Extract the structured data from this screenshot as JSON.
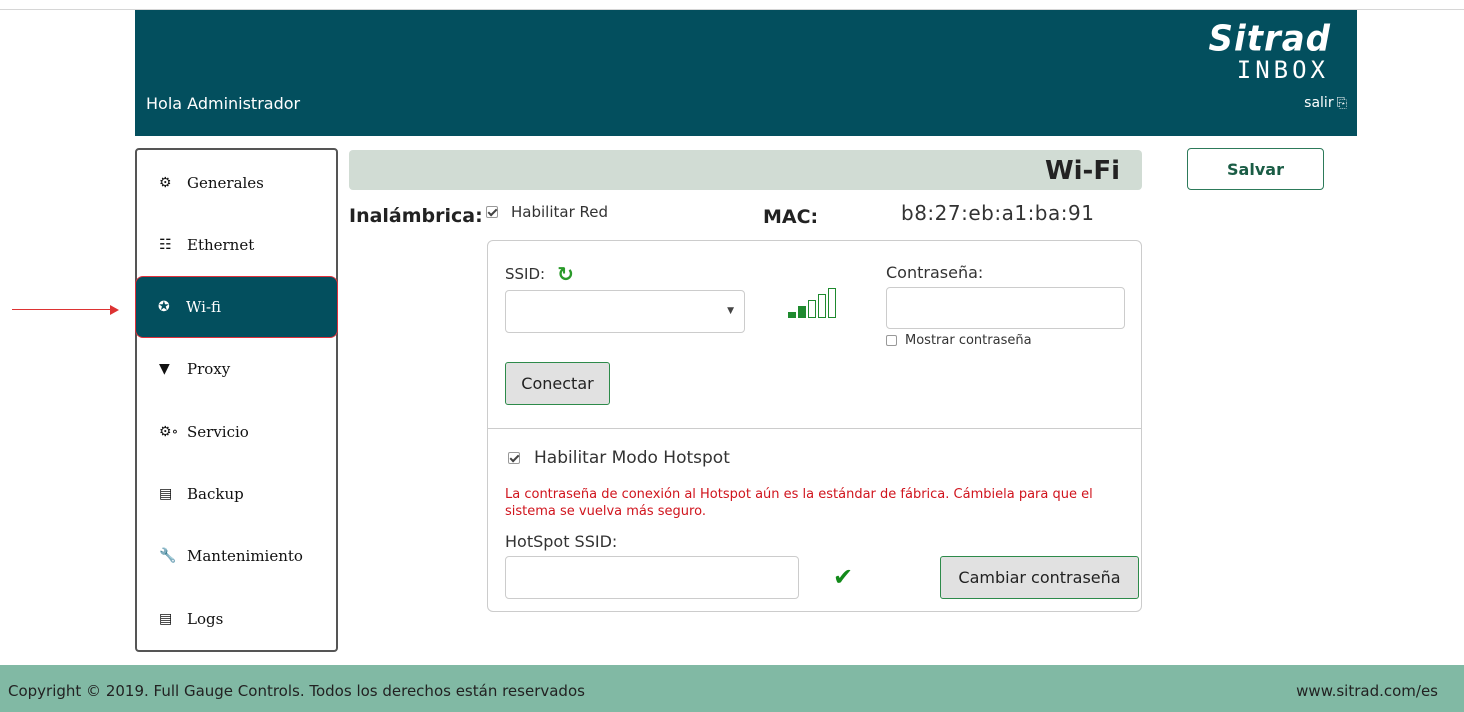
{
  "header": {
    "greeting": "Hola Administrador",
    "logo_top": "Sitrad",
    "logo_bottom": "INBOX",
    "logout_label": "salir",
    "logout_icon": "sign-out-icon",
    "background": "#034f5e"
  },
  "sidebar": {
    "items": [
      {
        "label": "Generales",
        "icon": "gear-icon",
        "active": false
      },
      {
        "label": "Ethernet",
        "icon": "sitemap-icon",
        "active": false
      },
      {
        "label": "Wi-fi",
        "icon": "wifi-icon",
        "active": true
      },
      {
        "label": "Proxy",
        "icon": "filter-icon",
        "active": false
      },
      {
        "label": "Servicio",
        "icon": "cogs-icon",
        "active": false
      },
      {
        "label": "Backup",
        "icon": "hdd-icon",
        "active": false
      },
      {
        "label": "Mantenimiento",
        "icon": "wrench-icon",
        "active": false
      },
      {
        "label": "Logs",
        "icon": "file-text-icon",
        "active": false
      }
    ]
  },
  "page": {
    "title": "Wi-Fi",
    "save_label": "Salvar",
    "wireless_label": "Inalámbrica:",
    "enable_network_label": "Habilitar Red",
    "enable_network_checked": true,
    "mac_label": "MAC:",
    "mac_value": "b8:27:eb:a1:ba:91"
  },
  "wifi_panel": {
    "ssid_label": "SSID:",
    "ssid_selected": "",
    "signal_level": 2,
    "signal_max": 5,
    "password_label": "Contraseña:",
    "password_value": "",
    "show_password_label": "Mostrar contraseña",
    "show_password_checked": false,
    "connect_label": "Conectar"
  },
  "hotspot": {
    "enable_label": "Habilitar Modo Hotspot",
    "enable_checked": true,
    "warning": "La contraseña de conexión al Hotspot aún es la estándar de fábrica. Cámbiela para que el sistema se vuelva más seguro.",
    "ssid_label": "HotSpot SSID:",
    "ssid_value": "",
    "change_password_label": "Cambiar contraseña"
  },
  "footer": {
    "copyright": "Copyright © 2019.  Full Gauge Controls.   Todos los derechos están reservados",
    "site": "www.sitrad.com/es"
  },
  "colors": {
    "primary": "#034f5e",
    "footer": "#81b9a4",
    "warning": "#d0141d",
    "signal_active": "#1e8a2e"
  }
}
